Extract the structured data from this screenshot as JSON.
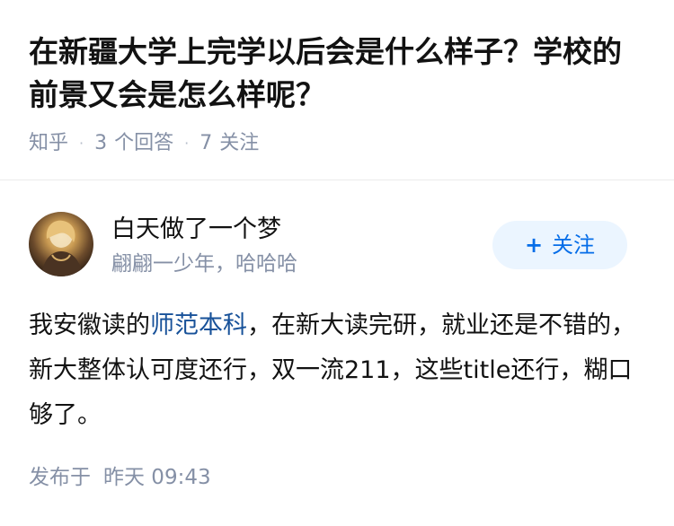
{
  "question": {
    "title": "在新疆大学上完学以后会是什么样子？学校的前景又会是怎么样呢？",
    "source": "知乎",
    "answer_count": "3",
    "answer_label": "个回答",
    "follow_count": "7",
    "follow_label": "关注",
    "separator": "·"
  },
  "author": {
    "name": "白天做了一个梦",
    "bio": "翩翩一少年，哈哈哈",
    "follow_button": "关注",
    "follow_plus": "+"
  },
  "answer": {
    "text_before": "我安徽读的",
    "link_text": "师范本科",
    "text_after": "，在新大读完研，就业还是不错的，新大整体认可度还行，双一流211，这些title还行，糊口够了。"
  },
  "footer": {
    "published_label": "发布于",
    "published_time": "昨天 09:43"
  }
}
